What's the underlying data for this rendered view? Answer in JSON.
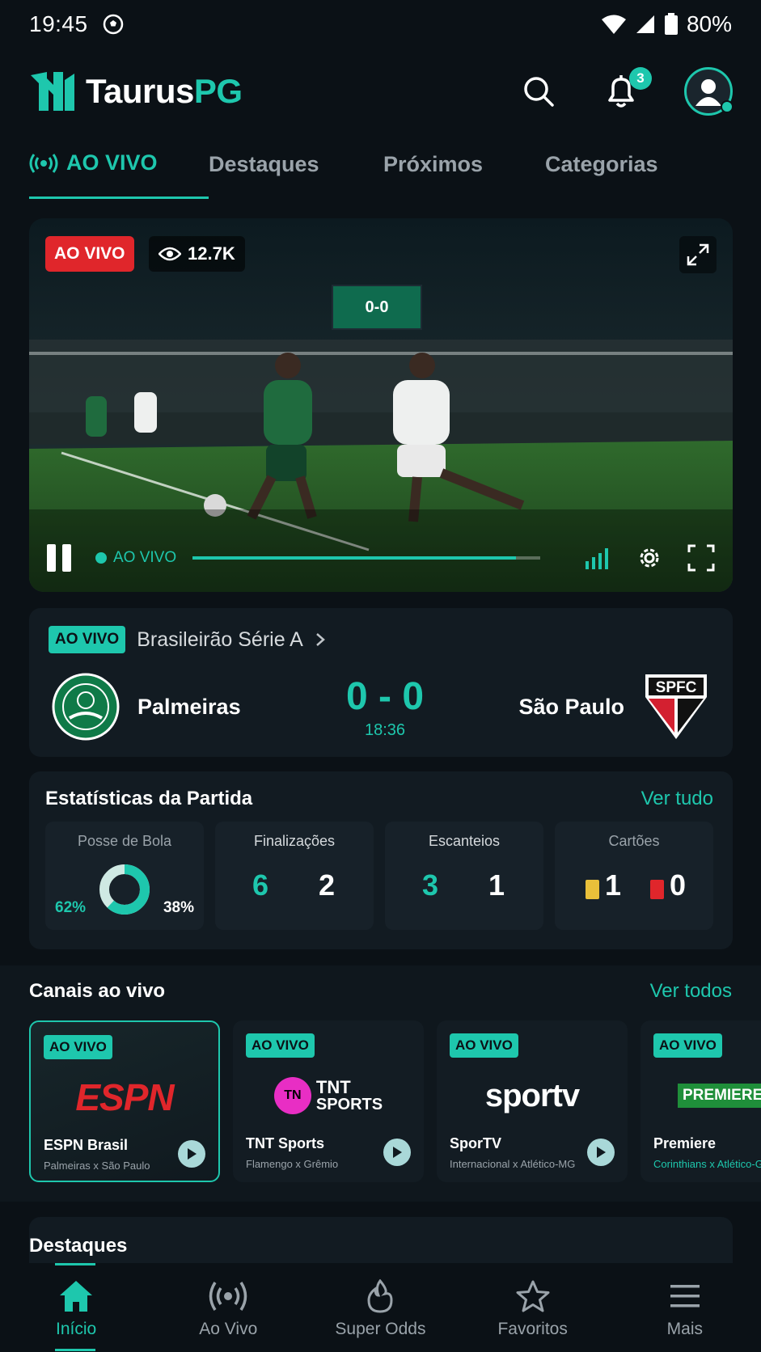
{
  "status": {
    "time": "19:45",
    "battery": "80%"
  },
  "header": {
    "logo_main": "Taurus",
    "logo_accent": "PG",
    "notification_count": "3"
  },
  "tabs": [
    {
      "label": "AO VIVO"
    },
    {
      "label": "Destaques"
    },
    {
      "label": "Próximos"
    },
    {
      "label": "Categorias"
    }
  ],
  "player": {
    "live_badge": "AO VIVO",
    "viewers": "12.7K",
    "scoreboard": "0-0",
    "live_indicator": "AO VIVO",
    "progress": 0.93
  },
  "match": {
    "tag": "AO VIVO",
    "competition": "Brasileirão Série A",
    "home": "Palmeiras",
    "away": "São Paulo",
    "score": "0 - 0",
    "clock": "18:36",
    "away_crest_text": "SPFC"
  },
  "stats": {
    "title": "Estatísticas da Partida",
    "link": "Ver tudo",
    "possession": {
      "label": "Posse de Bola",
      "home": "62%",
      "away": "38%",
      "home_fraction": 0.62
    },
    "shots": {
      "label": "Finalizações",
      "home": "6",
      "away": "2"
    },
    "corners": {
      "label": "Escanteios",
      "home": "3",
      "away": "1"
    },
    "cards": {
      "label": "Cartões",
      "yellow": "1",
      "red": "0"
    }
  },
  "channels": {
    "title": "Canais ao vivo",
    "link": "Ver todos",
    "items": [
      {
        "tag": "AO VIVO",
        "brand": "ESPN",
        "name": "ESPN Brasil",
        "match": "Palmeiras x São Paulo"
      },
      {
        "tag": "AO VIVO",
        "brand_top": "TNT",
        "brand_bottom": "SPORTS",
        "name": "TNT Sports",
        "match": "Flamengo x Grêmio"
      },
      {
        "tag": "AO VIVO",
        "brand": "sportv",
        "name": "SporTV",
        "match": "Internacional x Atlético-MG"
      },
      {
        "tag": "AO VIVO",
        "brand": "PREMIERE",
        "name": "Premiere",
        "match": "Corinthians x Atlético-GO"
      }
    ]
  },
  "highlights": {
    "title": "Destaques"
  },
  "nav": [
    {
      "label": "Início"
    },
    {
      "label": "Ao Vivo"
    },
    {
      "label": "Super Odds"
    },
    {
      "label": "Favoritos"
    },
    {
      "label": "Mais"
    }
  ],
  "colors": {
    "accent": "#1ec7ad",
    "live_red": "#e0262b",
    "background": "#0b1116",
    "card": "#121b22"
  }
}
